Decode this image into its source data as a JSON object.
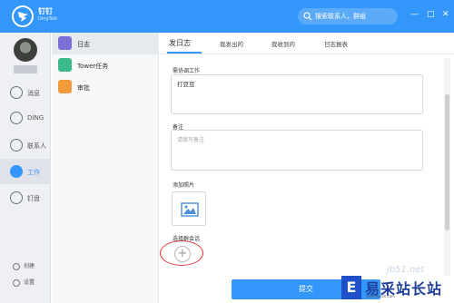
{
  "app": {
    "name": "钉钉",
    "subname": "DingTalk"
  },
  "search": {
    "placeholder": "搜索联系人，群组"
  },
  "window": {
    "minimize": "—",
    "maximize": "□",
    "close": "✕"
  },
  "rail": {
    "items": [
      {
        "label": "消息",
        "icon": "message-icon"
      },
      {
        "label": "DING",
        "icon": "ding-icon"
      },
      {
        "label": "联系人",
        "icon": "contacts-icon"
      },
      {
        "label": "工作",
        "icon": "work-icon"
      },
      {
        "label": "钉盘",
        "icon": "cloud-drive-icon"
      }
    ],
    "footer": [
      {
        "label": "创建"
      },
      {
        "label": "设置"
      }
    ]
  },
  "apps": {
    "items": [
      {
        "label": "日志",
        "color": "#7b6fd6"
      },
      {
        "label": "Tower任务",
        "color": "#3ab98a"
      },
      {
        "label": "审批",
        "color": "#f39a3b"
      }
    ]
  },
  "main": {
    "tabs": [
      "发日志",
      "我发出的",
      "我收到的",
      "日志报表"
    ],
    "fields": {
      "coordination_label": "需协调工作",
      "coordination_value": "打豆豆",
      "notes_label": "备注",
      "notes_placeholder": "请填写备注",
      "photo_label": "添加照片",
      "group_label": "选择群会话"
    },
    "submit": "提交"
  },
  "watermark": {
    "site": "jb51.net",
    "mark": "E",
    "cn": "易采站长站",
    "en": "www.easck.com"
  },
  "colors": {
    "accent": "#3296fa",
    "annotation": "#e23a3a"
  }
}
